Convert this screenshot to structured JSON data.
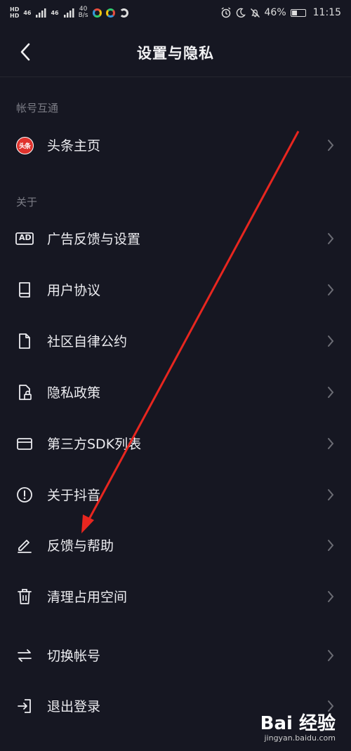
{
  "status_bar": {
    "hd1": "HD",
    "hd2": "HD",
    "net1": "46",
    "net2": "46",
    "speed_value": "40",
    "speed_unit": "B/s",
    "battery": "46%",
    "time": "11:15",
    "battery_level": 0.46
  },
  "header": {
    "title": "设置与隐私"
  },
  "sections": {
    "account_sync": "帐号互通",
    "about": "关于"
  },
  "rows": {
    "toutiao": {
      "label": "头条主页",
      "logo_text": "头条"
    },
    "ad": {
      "label": "广告反馈与设置",
      "icon_text": "AD"
    },
    "user_agreement": {
      "label": "用户协议"
    },
    "community": {
      "label": "社区自律公约"
    },
    "privacy": {
      "label": "隐私政策"
    },
    "sdk": {
      "label": "第三方SDK列表"
    },
    "about_app": {
      "label": "关于抖音"
    },
    "feedback": {
      "label": "反馈与帮助"
    },
    "clear_storage": {
      "label": "清理占用空间"
    },
    "switch_account": {
      "label": "切换帐号"
    },
    "logout": {
      "label": "退出登录"
    }
  },
  "watermark": {
    "logo": "Bai 经验",
    "url": "jingyan.baidu.com"
  },
  "colors": {
    "background": "#161722",
    "arrow": "#e8261f",
    "text": "#ececf0",
    "muted": "#7c7d86"
  }
}
